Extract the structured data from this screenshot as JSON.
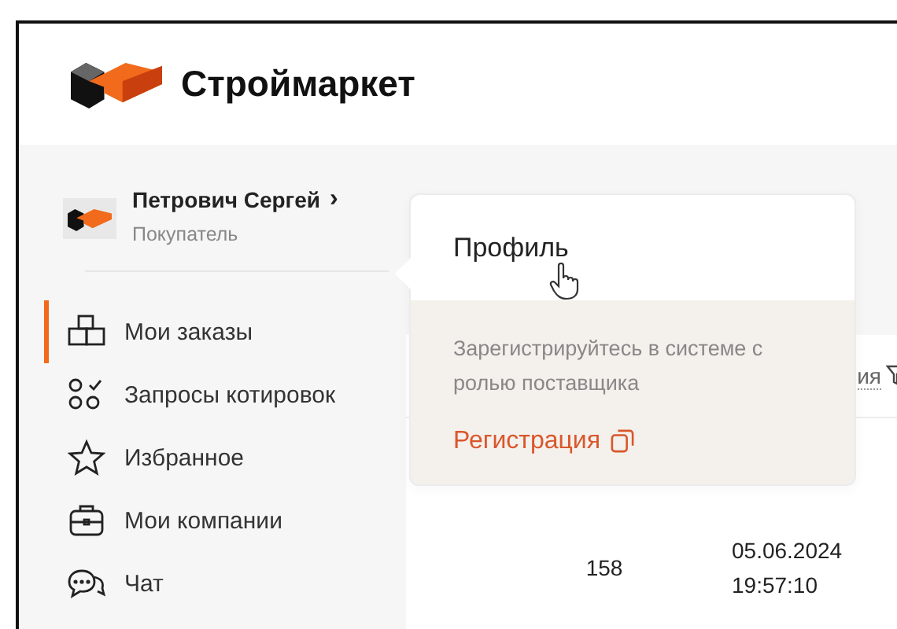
{
  "brand": {
    "name": "Строймаркет"
  },
  "user": {
    "name": "Петрович Сергей",
    "chevron": "›",
    "role": "Покупатель"
  },
  "menu": [
    {
      "label": "Мои заказы",
      "selected": true,
      "kind": "boxes"
    },
    {
      "label": "Запросы котировок",
      "selected": false,
      "kind": "quotes"
    },
    {
      "label": "Избранное",
      "selected": false,
      "kind": "star"
    },
    {
      "label": "Мои компании",
      "selected": false,
      "kind": "briefcase"
    },
    {
      "label": "Чат",
      "selected": false,
      "kind": "chat"
    }
  ],
  "popover": {
    "title": "Профиль",
    "message": "Зарегистрируйтесь в системе с ролью поставщика",
    "link": "Регистрация"
  },
  "table": {
    "column_partial": "ия",
    "rows": [
      {
        "cells": [
          "158",
          "05.06.2024 19:57:10"
        ]
      }
    ]
  }
}
